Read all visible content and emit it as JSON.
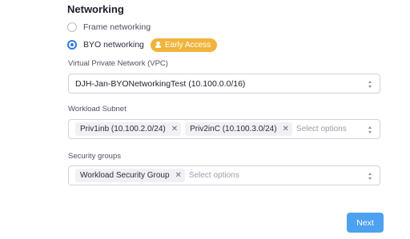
{
  "networking": {
    "title": "Networking",
    "options": [
      {
        "label": "Frame networking",
        "selected": false
      },
      {
        "label": "BYO networking",
        "selected": true
      }
    ],
    "badge": {
      "label": "Early Access",
      "icon": "person-icon",
      "color": "#f0b43c"
    }
  },
  "vpc": {
    "label": "Virtual Private Network (VPC)",
    "value": "DJH-Jan-BYONetworkingTest (10.100.0.0/16)"
  },
  "subnet": {
    "label": "Workload Subnet",
    "chips": [
      "Priv1inb (10.100.2.0/24)",
      "Priv2inC (10.100.3.0/24)"
    ],
    "placeholder": "Select options"
  },
  "security": {
    "label": "Security groups",
    "chips": [
      "Workload Security Group"
    ],
    "placeholder": "Select options"
  },
  "footer": {
    "next_label": "Next"
  },
  "colors": {
    "accent": "#2f7de1",
    "button": "#4da1ef",
    "badge": "#f0b43c"
  }
}
